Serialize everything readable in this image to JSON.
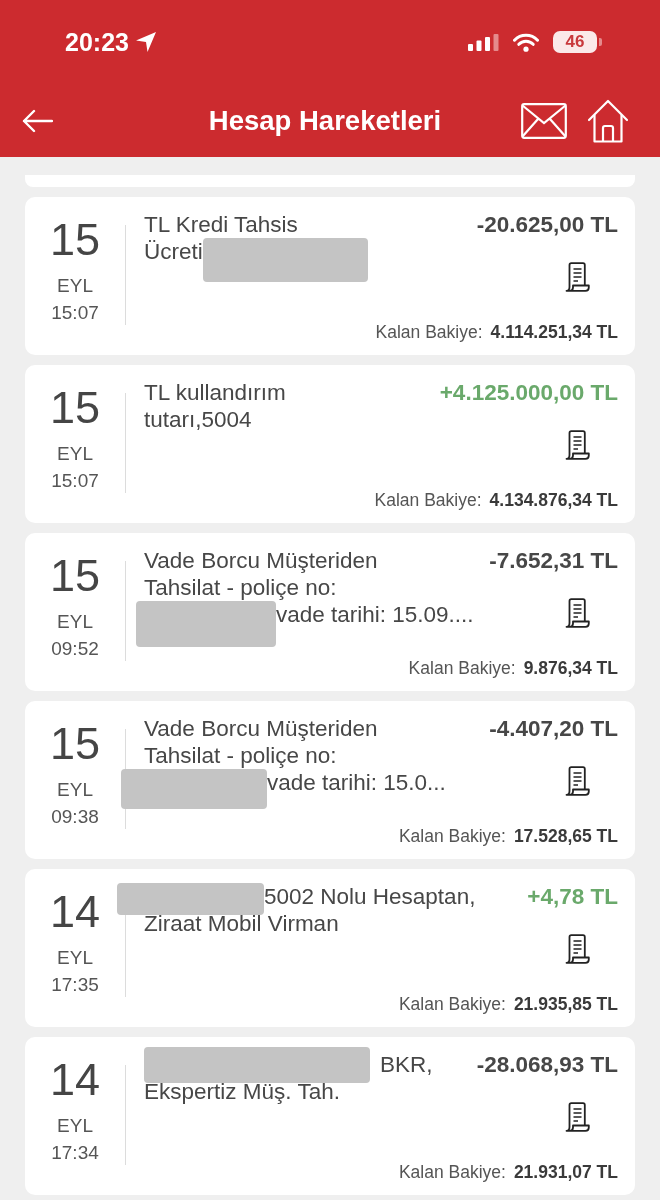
{
  "status_bar": {
    "time": "20:23",
    "battery": "46"
  },
  "header": {
    "title": "Hesap Hareketleri"
  },
  "transactions": [
    {
      "day": "15",
      "month": "EYL",
      "time": "15:07",
      "description": [
        [
          {
            "kind": "text",
            "text": "TL Kredi Tahsis"
          }
        ],
        [
          {
            "kind": "text",
            "text": "Ücreti"
          },
          {
            "kind": "redaction"
          }
        ]
      ],
      "amount": "-20.625,00 TL",
      "credit": false,
      "balance_label": "Kalan Bakiye:",
      "balance": "4.114.251,34 TL"
    },
    {
      "day": "15",
      "month": "EYL",
      "time": "15:07",
      "description": [
        [
          {
            "kind": "text",
            "text": "TL kullandırım"
          }
        ],
        [
          {
            "kind": "text",
            "text": "tutarı,5004"
          }
        ]
      ],
      "amount": "+4.125.000,00 TL",
      "credit": true,
      "balance_label": "Kalan Bakiye:",
      "balance": "4.134.876,34 TL"
    },
    {
      "day": "15",
      "month": "EYL",
      "time": "09:52",
      "description": [
        [
          {
            "kind": "text",
            "text": "Vade Borcu Müşteriden"
          }
        ],
        [
          {
            "kind": "text",
            "text": "Tahsilat - poliçe no:"
          }
        ],
        [
          {
            "kind": "redaction"
          },
          {
            "kind": "text",
            "text": "vade tarihi: 15.09...."
          }
        ]
      ],
      "amount": "-7.652,31 TL",
      "credit": false,
      "balance_label": "Kalan Bakiye:",
      "balance": "9.876,34 TL"
    },
    {
      "day": "15",
      "month": "EYL",
      "time": "09:38",
      "description": [
        [
          {
            "kind": "text",
            "text": "Vade Borcu Müşteriden"
          }
        ],
        [
          {
            "kind": "text",
            "text": "Tahsilat - poliçe no:"
          }
        ],
        [
          {
            "kind": "redaction"
          },
          {
            "kind": "text",
            "text": "vade tarihi: 15.0..."
          }
        ]
      ],
      "amount": "-4.407,20 TL",
      "credit": false,
      "balance_label": "Kalan Bakiye:",
      "balance": "17.528,65 TL"
    },
    {
      "day": "14",
      "month": "EYL",
      "time": "17:35",
      "description": [
        [
          {
            "kind": "redaction"
          },
          {
            "kind": "text",
            "text": "5002 Nolu Hesaptan,"
          }
        ],
        [
          {
            "kind": "text",
            "text": "Ziraat Mobil Virman"
          }
        ]
      ],
      "amount": "+4,78 TL",
      "credit": true,
      "balance_label": "Kalan Bakiye:",
      "balance": "21.935,85 TL"
    },
    {
      "day": "14",
      "month": "EYL",
      "time": "17:34",
      "description": [
        [
          {
            "kind": "redaction"
          },
          {
            "kind": "text",
            "text": "BKR,"
          }
        ],
        [
          {
            "kind": "text",
            "text": "Ekspertiz Müş. Tah."
          }
        ]
      ],
      "amount": "-28.068,93 TL",
      "credit": false,
      "balance_label": "Kalan Bakiye:",
      "balance": "21.931,07 TL"
    }
  ]
}
